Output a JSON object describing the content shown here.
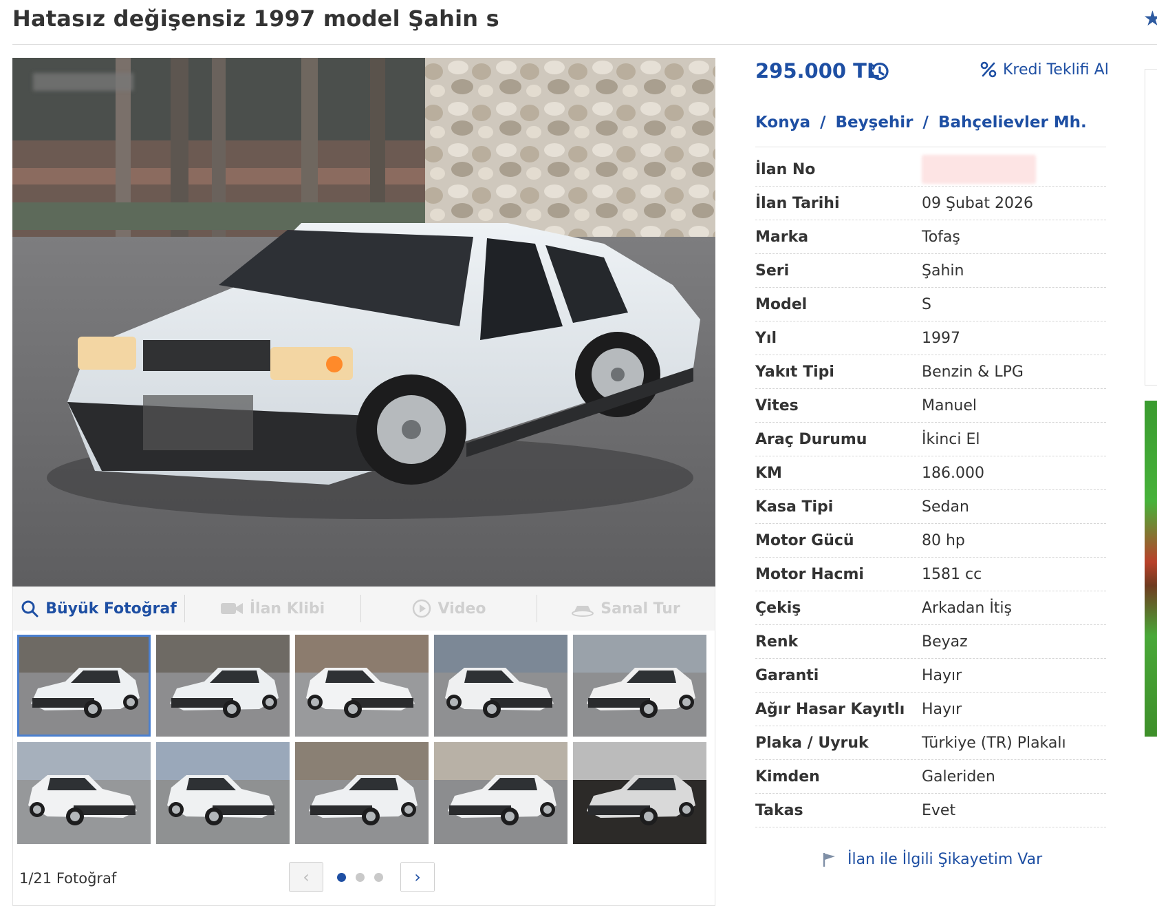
{
  "listing": {
    "title": "Hatasız değişensiz 1997 model Şahin s",
    "price": "295.000 TL",
    "credit_label": "Kredi Teklifi Al"
  },
  "location": {
    "city": "Konya",
    "district": "Beyşehir",
    "neighborhood": "Bahçelievler Mh.",
    "separator": "/"
  },
  "details": [
    {
      "label": "İlan No",
      "value": ""
    },
    {
      "label": "İlan Tarihi",
      "value": "09 Şubat 2026"
    },
    {
      "label": "Marka",
      "value": "Tofaş"
    },
    {
      "label": "Seri",
      "value": "Şahin"
    },
    {
      "label": "Model",
      "value": "S"
    },
    {
      "label": "Yıl",
      "value": "1997"
    },
    {
      "label": "Yakıt Tipi",
      "value": "Benzin & LPG"
    },
    {
      "label": "Vites",
      "value": "Manuel"
    },
    {
      "label": "Araç Durumu",
      "value": "İkinci El"
    },
    {
      "label": "KM",
      "value": "186.000"
    },
    {
      "label": "Kasa Tipi",
      "value": "Sedan"
    },
    {
      "label": "Motor Gücü",
      "value": "80 hp"
    },
    {
      "label": "Motor Hacmi",
      "value": "1581 cc"
    },
    {
      "label": "Çekiş",
      "value": "Arkadan İtiş"
    },
    {
      "label": "Renk",
      "value": "Beyaz"
    },
    {
      "label": "Garanti",
      "value": "Hayır"
    },
    {
      "label": "Ağır Hasar Kayıtlı",
      "value": "Hayır"
    },
    {
      "label": "Plaka / Uyruk",
      "value": "Türkiye (TR) Plakalı"
    },
    {
      "label": "Kimden",
      "value": "Galeriden"
    },
    {
      "label": "Takas",
      "value": "Evet"
    }
  ],
  "media_tabs": {
    "big_photo": "Büyük Fotoğraf",
    "clip": "İlan Klibi",
    "video": "Video",
    "virtual_tour": "Sanal Tur"
  },
  "gallery": {
    "counter": "1/21 Fotoğraf",
    "pages": 3,
    "current_page": 1,
    "selected_thumb": 1
  },
  "complaint": "İlan ile İlgili Şikayetim Var",
  "icons": {
    "price_history": "history-icon",
    "credit": "percent-icon",
    "favorite": "star-icon",
    "search": "magnifier-icon",
    "clip": "camera-icon",
    "video": "play-icon",
    "tour": "car-360-icon",
    "complaint": "flag-icon"
  },
  "colors": {
    "accent": "#1e4fa3",
    "disabled": "#cfcfcf",
    "thumb_selected": "#4a7fcf"
  }
}
